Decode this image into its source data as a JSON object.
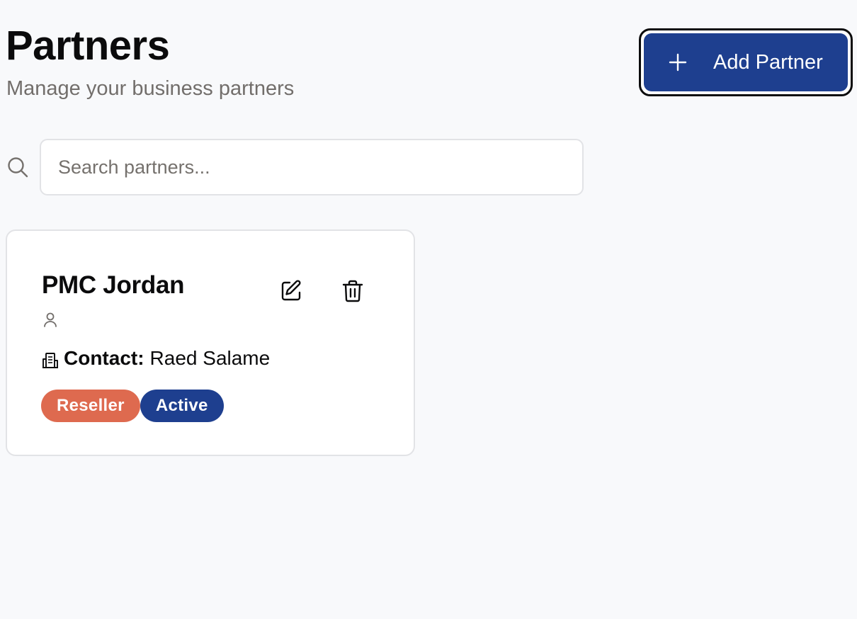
{
  "header": {
    "title": "Partners",
    "subtitle": "Manage your business partners",
    "add_button_label": "Add Partner"
  },
  "search": {
    "placeholder": "Search partners...",
    "value": ""
  },
  "partners": [
    {
      "name": "PMC Jordan",
      "contact_label": "Contact:",
      "contact_name": "Raed Salame",
      "badges": [
        {
          "label": "Reseller",
          "color": "#de6a4f"
        },
        {
          "label": "Active",
          "color": "#1e3f8f"
        }
      ]
    }
  ],
  "icons": {
    "add": "plus-icon",
    "search": "search-icon",
    "edit": "pencil-square-icon",
    "delete": "trash-icon",
    "user": "user-icon",
    "company": "building-icon"
  },
  "colors": {
    "primary": "#1e3f8f",
    "accent": "#de6a4f",
    "background": "#f8f9fb",
    "muted_text": "#726e6b"
  }
}
